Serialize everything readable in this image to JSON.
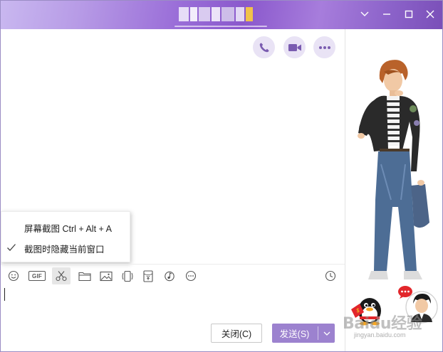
{
  "colors": {
    "accent": "#9c82cf",
    "round_button_bg": "#e9e3f5",
    "icon_purple": "#7a5cb0"
  },
  "titlebar": {
    "title_redacted": true,
    "icons": [
      "chevron-down-icon",
      "minimize-icon",
      "maximize-icon",
      "close-icon"
    ]
  },
  "header_actions": [
    "phone-icon",
    "video-call-icon",
    "more-icon"
  ],
  "context_menu": {
    "items": [
      {
        "label": "屏幕截图 Ctrl + Alt + A",
        "checked": false
      },
      {
        "label": "截图时隐藏当前窗口",
        "checked": true
      }
    ]
  },
  "toolbar": {
    "gif_label": "GIF",
    "tools": [
      "emoji-icon",
      "gif-icon",
      "scissors-icon",
      "folder-icon",
      "image-icon",
      "shake-icon",
      "red-packet-icon",
      "music-icon",
      "more-tools-icon"
    ],
    "history_icon": "clock-icon"
  },
  "buttons": {
    "close_label": "关闭(C)",
    "send_label": "发送(S)"
  },
  "watermark": {
    "text": "Baidu经验",
    "url": "jingyan.baidu.com"
  },
  "side_panel": {
    "badge_icon": "chat-bubble-icon"
  }
}
